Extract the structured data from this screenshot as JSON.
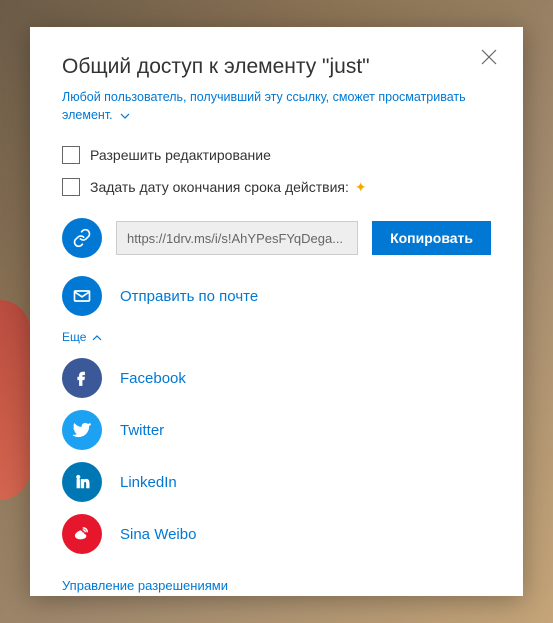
{
  "title": "Общий доступ к элементу \"just\"",
  "subtitle": "Любой пользователь, получивший эту ссылку, сможет просматривать элемент.",
  "checkboxes": {
    "allow_editing": "Разрешить редактирование",
    "set_expiry": "Задать дату окончания срока действия:"
  },
  "link": {
    "url": "https://1drv.ms/i/s!AhYPesFYqDega...",
    "copy_label": "Копировать"
  },
  "email": {
    "label": "Отправить по почте"
  },
  "more_toggle": "Еще",
  "social": {
    "facebook": "Facebook",
    "twitter": "Twitter",
    "linkedin": "LinkedIn",
    "weibo": "Sina Weibo"
  },
  "manage_permissions": "Управление разрешениями",
  "colors": {
    "accent": "#0078d4",
    "facebook": "#3b5998",
    "twitter": "#1da1f2",
    "linkedin": "#0077b5",
    "weibo": "#e6162d"
  }
}
